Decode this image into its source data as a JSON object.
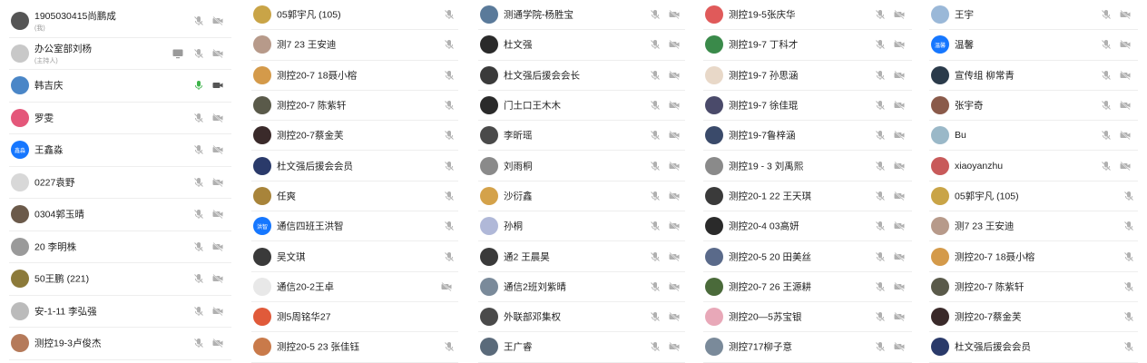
{
  "colors": {
    "muted_icon": "#b0b0b0",
    "active_mic": "#3db34a",
    "active_cam": "#555555",
    "divider": "#eeeeee",
    "blue_avatar": "#1677ff"
  },
  "columns": [
    {
      "participants": [
        {
          "name": "1905030415尚鹏成",
          "sub": "(我)",
          "avatar": "photo",
          "avatar_color": "#555",
          "mic": "muted",
          "cam": "off"
        },
        {
          "name": "办公室部刘杨",
          "sub": "(主持人)",
          "avatar": "photo",
          "avatar_color": "#c8c8c8",
          "mic": "muted",
          "cam": "off",
          "screen": true
        },
        {
          "name": "韩吉庆",
          "avatar": "photo",
          "avatar_color": "#4a86c7",
          "mic": "on",
          "cam": "on"
        },
        {
          "name": "罗雯",
          "avatar": "photo",
          "avatar_color": "#e4577a",
          "mic": "muted",
          "cam": "off"
        },
        {
          "name": "王鑫淼",
          "avatar": "text",
          "avatar_text": "鑫淼",
          "avatar_color": "#1677ff",
          "mic": "muted",
          "cam": "off"
        },
        {
          "name": "0227袁野",
          "avatar": "photo",
          "avatar_color": "#d8d8d8",
          "mic": "muted",
          "cam": "off"
        },
        {
          "name": "0304郭玉晴",
          "avatar": "photo",
          "avatar_color": "#6b5a4a",
          "mic": "muted",
          "cam": "off"
        },
        {
          "name": "20 李明株",
          "avatar": "photo",
          "avatar_color": "#9a9a9a",
          "mic": "muted",
          "cam": "off"
        },
        {
          "name": "50王鹏 (221)",
          "avatar": "photo",
          "avatar_color": "#8c7a3a",
          "mic": "muted",
          "cam": "off"
        },
        {
          "name": "安-1-11 李弘强",
          "avatar": "photo",
          "avatar_color": "#bbbbbb",
          "mic": "muted",
          "cam": "off"
        },
        {
          "name": "测控19-3卢俊杰",
          "avatar": "photo",
          "avatar_color": "#b57a5a",
          "mic": "muted",
          "cam": "off"
        }
      ]
    },
    {
      "participants": [
        {
          "name": "05郭宇凡 (105)",
          "avatar": "photo",
          "avatar_color": "#c9a447",
          "mic": "muted"
        },
        {
          "name": "测7 23 王安迪",
          "avatar": "photo",
          "avatar_color": "#b79a8a",
          "mic": "muted"
        },
        {
          "name": "测控20-7    18聂小榕",
          "avatar": "photo",
          "avatar_color": "#d49a4a",
          "mic": "muted"
        },
        {
          "name": "测控20-7    陈紫轩",
          "avatar": "photo",
          "avatar_color": "#5a5a4a",
          "mic": "muted"
        },
        {
          "name": "测控20-7蔡金芙",
          "avatar": "photo",
          "avatar_color": "#3a2a2a",
          "mic": "muted"
        },
        {
          "name": "杜文强后援会会员",
          "avatar": "photo",
          "avatar_color": "#2a3a6a",
          "mic": "muted"
        },
        {
          "name": "任爽",
          "avatar": "photo",
          "avatar_color": "#a8843a",
          "mic": "muted"
        },
        {
          "name": "通信四班王洪智",
          "avatar": "text",
          "avatar_text": "洪智",
          "avatar_color": "#1677ff",
          "mic": "muted"
        },
        {
          "name": "吴文琪",
          "avatar": "photo",
          "avatar_color": "#3a3a3a",
          "mic": "muted"
        },
        {
          "name": "通信20-2王卓",
          "avatar": "photo",
          "avatar_color": "#e8e8e8",
          "cam": "off"
        },
        {
          "name": "测5周铭华27",
          "avatar": "photo",
          "avatar_color": "#e05a3a",
          "mic": "none"
        },
        {
          "name": "测控20-5 23 张佳钰",
          "avatar": "photo",
          "avatar_color": "#c97a4a",
          "mic": "muted"
        }
      ]
    },
    {
      "participants": [
        {
          "name": "测通学院-杨胜宝",
          "avatar": "photo",
          "avatar_color": "#5a7a9a",
          "mic": "muted",
          "cam": "off"
        },
        {
          "name": "杜文强",
          "avatar": "photo",
          "avatar_color": "#2a2a2a",
          "mic": "muted",
          "cam": "off"
        },
        {
          "name": "杜文强后援会会长",
          "avatar": "photo",
          "avatar_color": "#3a3a3a",
          "mic": "muted",
          "cam": "off"
        },
        {
          "name": "门土口王木木",
          "avatar": "photo",
          "avatar_color": "#2a2a2a",
          "mic": "muted",
          "cam": "off"
        },
        {
          "name": "李昕瑶",
          "avatar": "photo",
          "avatar_color": "#4a4a4a",
          "mic": "muted",
          "cam": "off"
        },
        {
          "name": "刘雨桐",
          "avatar": "photo",
          "avatar_color": "#8a8a8a",
          "mic": "muted",
          "cam": "off"
        },
        {
          "name": "沙衍鑫",
          "avatar": "photo",
          "avatar_color": "#d4a24a",
          "mic": "muted",
          "cam": "off"
        },
        {
          "name": "孙桐",
          "avatar": "photo",
          "avatar_color": "#b0b8d8",
          "mic": "muted",
          "cam": "off"
        },
        {
          "name": "通2 王晨昊",
          "avatar": "photo",
          "avatar_color": "#3a3a3a",
          "mic": "muted",
          "cam": "off"
        },
        {
          "name": "通信2班刘紫晴",
          "avatar": "photo",
          "avatar_color": "#7a8a9a",
          "mic": "muted",
          "cam": "off"
        },
        {
          "name": "外联部邓集权",
          "avatar": "photo",
          "avatar_color": "#4a4a4a",
          "mic": "muted",
          "cam": "off"
        },
        {
          "name": "王广睿",
          "avatar": "photo",
          "avatar_color": "#5a6a7a",
          "mic": "muted",
          "cam": "off"
        }
      ]
    },
    {
      "participants": [
        {
          "name": "测控19-5张庆华",
          "avatar": "photo",
          "avatar_color": "#e05a5a",
          "mic": "muted",
          "cam": "off"
        },
        {
          "name": "测控19-7 丁科才",
          "avatar": "photo",
          "avatar_color": "#3a8a4a",
          "mic": "muted",
          "cam": "off"
        },
        {
          "name": "测控19-7 孙思涵",
          "avatar": "photo",
          "avatar_color": "#e8d8c8",
          "mic": "muted",
          "cam": "off"
        },
        {
          "name": "测控19-7 徐佳琨",
          "avatar": "photo",
          "avatar_color": "#4a4a6a",
          "mic": "muted",
          "cam": "off"
        },
        {
          "name": "测控19-7鲁梓涵",
          "avatar": "photo",
          "avatar_color": "#3a4a6a",
          "mic": "muted",
          "cam": "off"
        },
        {
          "name": "测控19 - 3  刘禹熙",
          "avatar": "photo",
          "avatar_color": "#8a8a8a",
          "mic": "muted",
          "cam": "off"
        },
        {
          "name": "测控20-1   22  王天琪",
          "avatar": "photo",
          "avatar_color": "#3a3a3a",
          "mic": "muted",
          "cam": "off"
        },
        {
          "name": "测控20-4 03高妍",
          "avatar": "photo",
          "avatar_color": "#2a2a2a",
          "mic": "muted",
          "cam": "off"
        },
        {
          "name": "测控20-5    20    田美丝",
          "avatar": "photo",
          "avatar_color": "#5a6a8a",
          "mic": "muted",
          "cam": "off"
        },
        {
          "name": "测控20-7 26 王源耕",
          "avatar": "photo",
          "avatar_color": "#4a6a3a",
          "mic": "muted",
          "cam": "off"
        },
        {
          "name": "测控20—5苏宝银",
          "avatar": "photo",
          "avatar_color": "#e8a8b8",
          "mic": "muted",
          "cam": "off"
        },
        {
          "name": "测控717柳子意",
          "avatar": "photo",
          "avatar_color": "#7a8a9a",
          "mic": "muted",
          "cam": "off"
        }
      ]
    },
    {
      "participants": [
        {
          "name": "王宇",
          "avatar": "photo",
          "avatar_color": "#9ab8d8",
          "mic": "muted",
          "cam": "off"
        },
        {
          "name": "温馨",
          "avatar": "text",
          "avatar_text": "温馨",
          "avatar_color": "#1677ff",
          "mic": "muted",
          "cam": "off"
        },
        {
          "name": "宣传组  柳常青",
          "avatar": "photo",
          "avatar_color": "#2a3a4a",
          "mic": "muted",
          "cam": "off"
        },
        {
          "name": "张宇奇",
          "avatar": "photo",
          "avatar_color": "#8a5a4a",
          "mic": "muted",
          "cam": "off"
        },
        {
          "name": "Bu",
          "avatar": "photo",
          "avatar_color": "#9ab8c8",
          "mic": "muted",
          "cam": "off"
        },
        {
          "name": "xiaoyanzhu",
          "avatar": "photo",
          "avatar_color": "#c85a5a",
          "mic": "muted",
          "cam": "off"
        },
        {
          "name": "05郭宇凡 (105)",
          "avatar": "photo",
          "avatar_color": "#c9a447",
          "mic": "muted"
        },
        {
          "name": "测7 23 王安迪",
          "avatar": "photo",
          "avatar_color": "#b79a8a",
          "mic": "muted"
        },
        {
          "name": "测控20-7    18聂小榕",
          "avatar": "photo",
          "avatar_color": "#d49a4a",
          "mic": "muted"
        },
        {
          "name": "测控20-7    陈紫轩",
          "avatar": "photo",
          "avatar_color": "#5a5a4a",
          "mic": "muted"
        },
        {
          "name": "测控20-7蔡金芙",
          "avatar": "photo",
          "avatar_color": "#3a2a2a",
          "mic": "muted"
        },
        {
          "name": "杜文强后援会会员",
          "avatar": "photo",
          "avatar_color": "#2a3a6a",
          "mic": "muted"
        }
      ]
    }
  ]
}
